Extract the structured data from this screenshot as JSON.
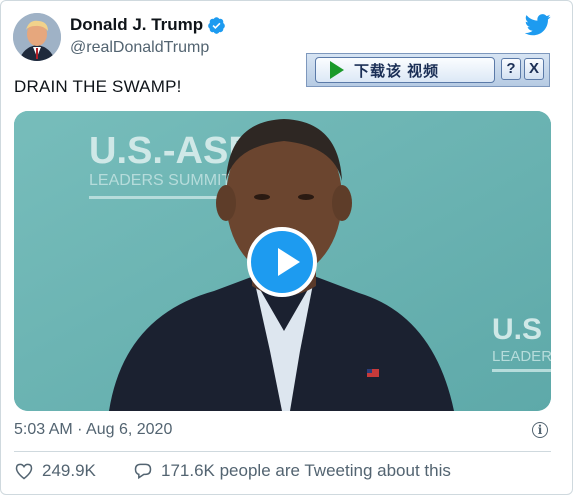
{
  "tweet": {
    "name": "Donald J. Trump",
    "handle": "@realDonaldTrump",
    "text": "DRAIN THE SWAMP!",
    "timestamp": "5:03 AM · Aug 6, 2020",
    "likes": "249.9K",
    "tweeting_text": "171.6K people are Tweeting about this"
  },
  "video": {
    "backdrop_line1": "U.S.-ASEAN",
    "backdrop_line2": "LEADERS SUMMIT",
    "backdrop_right": "U.S",
    "backdrop_right2": "LEADER"
  },
  "download_bar": {
    "label": "下载该 视频",
    "help": "?",
    "close": "X"
  },
  "colors": {
    "twitter_blue": "#1d9bf0",
    "text_primary": "#0f1419",
    "text_secondary": "#536471",
    "video_bg": "#68b1b0"
  },
  "icons": [
    "verified-badge-icon",
    "twitter-bird-icon",
    "play-icon",
    "info-icon",
    "heart-icon",
    "reply-bubble-icon"
  ]
}
